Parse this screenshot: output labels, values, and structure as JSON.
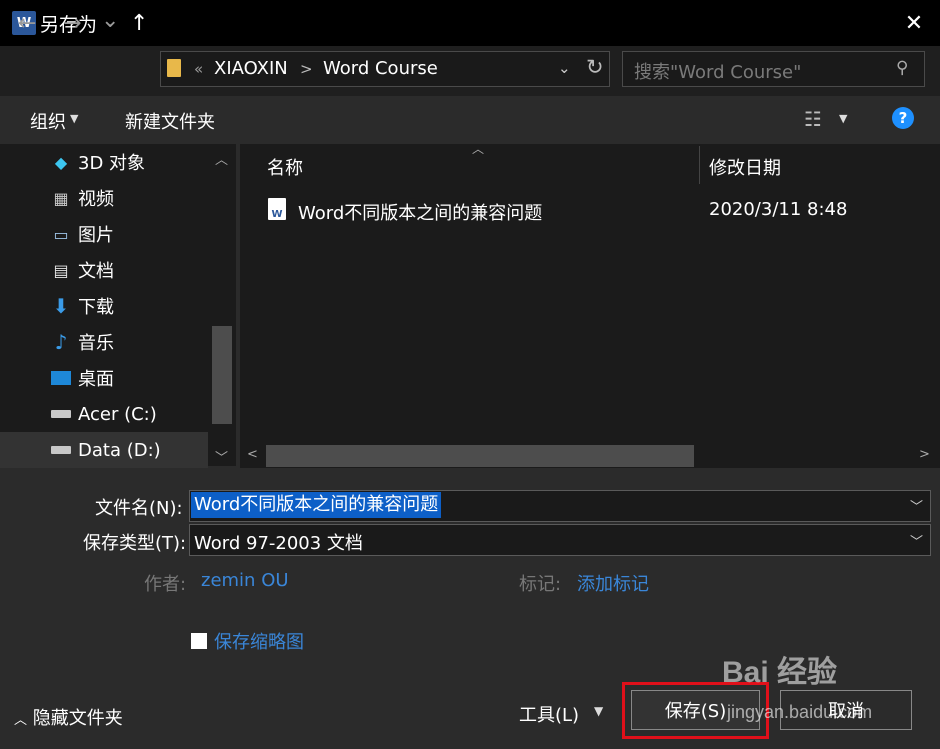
{
  "window": {
    "title": "另存为",
    "app_icon": "W"
  },
  "nav": {
    "back": "←",
    "forward": "→",
    "recent": "⌄",
    "up": "↑",
    "breadcrumb_prefix": "«",
    "breadcrumb": [
      "XIAOXIN",
      "Word Course"
    ],
    "search_placeholder": "搜索\"Word Course\""
  },
  "toolbar": {
    "organize": "组织",
    "new_folder": "新建文件夹"
  },
  "sidebar": {
    "items": [
      {
        "label": "3D 对象",
        "icon": "cube-icon"
      },
      {
        "label": "视频",
        "icon": "video-icon"
      },
      {
        "label": "图片",
        "icon": "pictures-icon"
      },
      {
        "label": "文档",
        "icon": "documents-icon"
      },
      {
        "label": "下载",
        "icon": "download-icon"
      },
      {
        "label": "音乐",
        "icon": "music-icon"
      },
      {
        "label": "桌面",
        "icon": "desktop-icon"
      },
      {
        "label": "Acer (C:)",
        "icon": "drive-icon"
      },
      {
        "label": "Data (D:)",
        "icon": "drive-icon"
      }
    ],
    "selected_index": 8
  },
  "file_list": {
    "columns": [
      "名称",
      "修改日期"
    ],
    "rows": [
      {
        "name": "Word不同版本之间的兼容问题",
        "modified": "2020/3/11 8:48"
      }
    ]
  },
  "form": {
    "filename_label": "文件名(N):",
    "filename_value": "Word不同版本之间的兼容问题",
    "filetype_label": "保存类型(T):",
    "filetype_value": "Word 97-2003 文档",
    "author_label": "作者:",
    "author_value": "zemin OU",
    "tags_label": "标记:",
    "tags_value": "添加标记",
    "save_thumbnail_label": "保存缩略图"
  },
  "footer": {
    "hide_folders": "隐藏文件夹",
    "tools": "工具(L)",
    "save": "保存(S)",
    "cancel": "取消"
  },
  "watermark": {
    "logo": "Bai 经验",
    "url": "jingyan.baidu.com"
  },
  "colors": {
    "accent": "#0d5fc7",
    "link": "#3a86d8",
    "highlight_border": "#e0101a"
  }
}
